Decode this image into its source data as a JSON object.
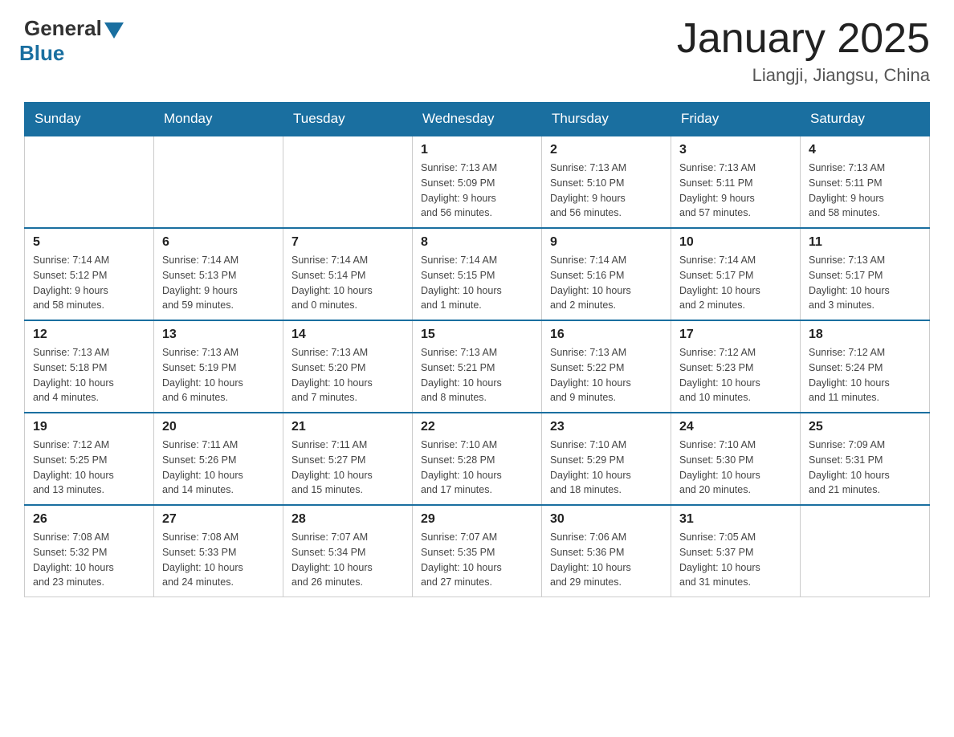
{
  "header": {
    "logo_general": "General",
    "logo_blue": "Blue",
    "title": "January 2025",
    "subtitle": "Liangji, Jiangsu, China"
  },
  "days_of_week": [
    "Sunday",
    "Monday",
    "Tuesday",
    "Wednesday",
    "Thursday",
    "Friday",
    "Saturday"
  ],
  "weeks": [
    [
      {
        "day": "",
        "info": ""
      },
      {
        "day": "",
        "info": ""
      },
      {
        "day": "",
        "info": ""
      },
      {
        "day": "1",
        "info": "Sunrise: 7:13 AM\nSunset: 5:09 PM\nDaylight: 9 hours\nand 56 minutes."
      },
      {
        "day": "2",
        "info": "Sunrise: 7:13 AM\nSunset: 5:10 PM\nDaylight: 9 hours\nand 56 minutes."
      },
      {
        "day": "3",
        "info": "Sunrise: 7:13 AM\nSunset: 5:11 PM\nDaylight: 9 hours\nand 57 minutes."
      },
      {
        "day": "4",
        "info": "Sunrise: 7:13 AM\nSunset: 5:11 PM\nDaylight: 9 hours\nand 58 minutes."
      }
    ],
    [
      {
        "day": "5",
        "info": "Sunrise: 7:14 AM\nSunset: 5:12 PM\nDaylight: 9 hours\nand 58 minutes."
      },
      {
        "day": "6",
        "info": "Sunrise: 7:14 AM\nSunset: 5:13 PM\nDaylight: 9 hours\nand 59 minutes."
      },
      {
        "day": "7",
        "info": "Sunrise: 7:14 AM\nSunset: 5:14 PM\nDaylight: 10 hours\nand 0 minutes."
      },
      {
        "day": "8",
        "info": "Sunrise: 7:14 AM\nSunset: 5:15 PM\nDaylight: 10 hours\nand 1 minute."
      },
      {
        "day": "9",
        "info": "Sunrise: 7:14 AM\nSunset: 5:16 PM\nDaylight: 10 hours\nand 2 minutes."
      },
      {
        "day": "10",
        "info": "Sunrise: 7:14 AM\nSunset: 5:17 PM\nDaylight: 10 hours\nand 2 minutes."
      },
      {
        "day": "11",
        "info": "Sunrise: 7:13 AM\nSunset: 5:17 PM\nDaylight: 10 hours\nand 3 minutes."
      }
    ],
    [
      {
        "day": "12",
        "info": "Sunrise: 7:13 AM\nSunset: 5:18 PM\nDaylight: 10 hours\nand 4 minutes."
      },
      {
        "day": "13",
        "info": "Sunrise: 7:13 AM\nSunset: 5:19 PM\nDaylight: 10 hours\nand 6 minutes."
      },
      {
        "day": "14",
        "info": "Sunrise: 7:13 AM\nSunset: 5:20 PM\nDaylight: 10 hours\nand 7 minutes."
      },
      {
        "day": "15",
        "info": "Sunrise: 7:13 AM\nSunset: 5:21 PM\nDaylight: 10 hours\nand 8 minutes."
      },
      {
        "day": "16",
        "info": "Sunrise: 7:13 AM\nSunset: 5:22 PM\nDaylight: 10 hours\nand 9 minutes."
      },
      {
        "day": "17",
        "info": "Sunrise: 7:12 AM\nSunset: 5:23 PM\nDaylight: 10 hours\nand 10 minutes."
      },
      {
        "day": "18",
        "info": "Sunrise: 7:12 AM\nSunset: 5:24 PM\nDaylight: 10 hours\nand 11 minutes."
      }
    ],
    [
      {
        "day": "19",
        "info": "Sunrise: 7:12 AM\nSunset: 5:25 PM\nDaylight: 10 hours\nand 13 minutes."
      },
      {
        "day": "20",
        "info": "Sunrise: 7:11 AM\nSunset: 5:26 PM\nDaylight: 10 hours\nand 14 minutes."
      },
      {
        "day": "21",
        "info": "Sunrise: 7:11 AM\nSunset: 5:27 PM\nDaylight: 10 hours\nand 15 minutes."
      },
      {
        "day": "22",
        "info": "Sunrise: 7:10 AM\nSunset: 5:28 PM\nDaylight: 10 hours\nand 17 minutes."
      },
      {
        "day": "23",
        "info": "Sunrise: 7:10 AM\nSunset: 5:29 PM\nDaylight: 10 hours\nand 18 minutes."
      },
      {
        "day": "24",
        "info": "Sunrise: 7:10 AM\nSunset: 5:30 PM\nDaylight: 10 hours\nand 20 minutes."
      },
      {
        "day": "25",
        "info": "Sunrise: 7:09 AM\nSunset: 5:31 PM\nDaylight: 10 hours\nand 21 minutes."
      }
    ],
    [
      {
        "day": "26",
        "info": "Sunrise: 7:08 AM\nSunset: 5:32 PM\nDaylight: 10 hours\nand 23 minutes."
      },
      {
        "day": "27",
        "info": "Sunrise: 7:08 AM\nSunset: 5:33 PM\nDaylight: 10 hours\nand 24 minutes."
      },
      {
        "day": "28",
        "info": "Sunrise: 7:07 AM\nSunset: 5:34 PM\nDaylight: 10 hours\nand 26 minutes."
      },
      {
        "day": "29",
        "info": "Sunrise: 7:07 AM\nSunset: 5:35 PM\nDaylight: 10 hours\nand 27 minutes."
      },
      {
        "day": "30",
        "info": "Sunrise: 7:06 AM\nSunset: 5:36 PM\nDaylight: 10 hours\nand 29 minutes."
      },
      {
        "day": "31",
        "info": "Sunrise: 7:05 AM\nSunset: 5:37 PM\nDaylight: 10 hours\nand 31 minutes."
      },
      {
        "day": "",
        "info": ""
      }
    ]
  ]
}
